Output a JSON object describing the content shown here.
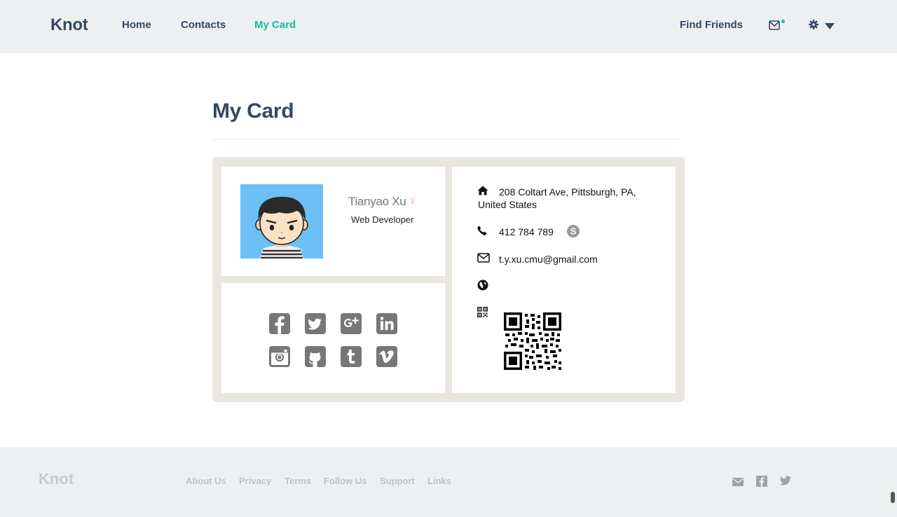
{
  "nav": {
    "brand": "Knot",
    "links": [
      {
        "label": "Home"
      },
      {
        "label": "Contacts"
      },
      {
        "label": "My Card"
      }
    ],
    "find_friends": "Find Friends"
  },
  "page": {
    "title": "My Card"
  },
  "profile": {
    "name": "Tianyao Xu",
    "gender_symbol": "♀",
    "role": "Web Developer"
  },
  "social": [
    "facebook-icon",
    "twitter-icon",
    "google-plus-icon",
    "linkedin-icon",
    "instagram-icon",
    "github-icon",
    "tumblr-icon",
    "vimeo-icon"
  ],
  "contact": {
    "address": "208 Coltart Ave, Pittsburgh, PA, United States",
    "phone": "412 784 789",
    "email": "t.y.xu.cmu@gmail.com"
  },
  "footer": {
    "brand": "Knot",
    "links": [
      "About Us",
      "Privacy",
      "Terms",
      "Follow Us",
      "Support",
      "Links"
    ]
  },
  "colors": {
    "accent": "#1abc9c",
    "text": "#34495e",
    "nav_bg": "#ecf0f1",
    "card_bg": "#e8e6df",
    "avatar_bg": "#6cc0f5"
  }
}
